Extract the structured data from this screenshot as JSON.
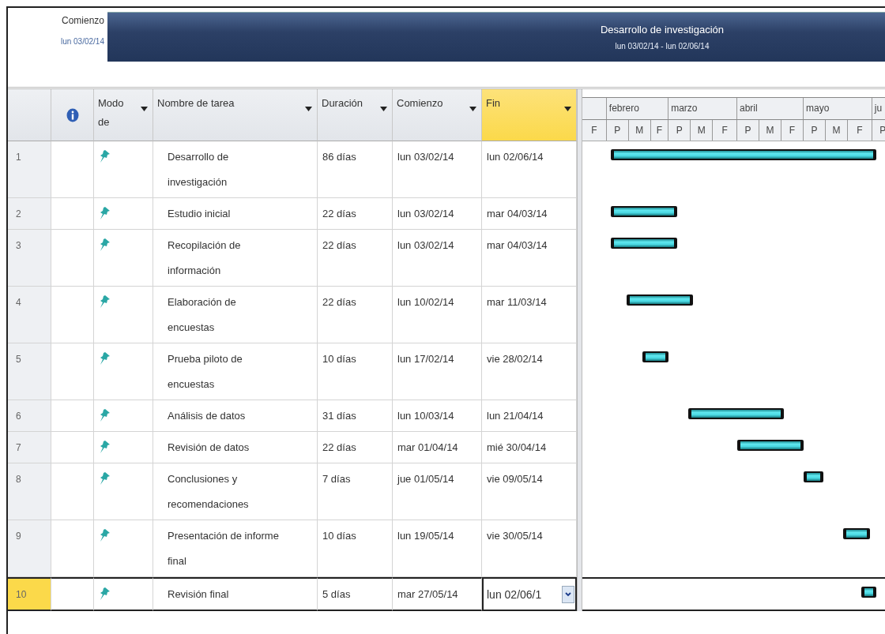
{
  "timeline": {
    "start_label": "Comienzo",
    "start_date": "lun 03/02/14",
    "bar_title": "Desarrollo de investigación",
    "bar_dates": "lun 03/02/14 - lun 02/06/14"
  },
  "table": {
    "columns": [
      {
        "label": "Modo de",
        "selected": false
      },
      {
        "label": "Nombre de tarea",
        "selected": false
      },
      {
        "label": "Duración",
        "selected": false
      },
      {
        "label": "Comienzo",
        "selected": false
      },
      {
        "label": "Fin",
        "selected": true
      }
    ],
    "rows": [
      {
        "id": "1",
        "name": "Desarrollo de investigación",
        "duration": "86 días",
        "start": "lun 03/02/14",
        "finish": "lun 02/06/14",
        "selected": false
      },
      {
        "id": "2",
        "name": "Estudio inicial",
        "duration": "22 días",
        "start": "lun 03/02/14",
        "finish": "mar 04/03/14",
        "selected": false
      },
      {
        "id": "3",
        "name": "Recopilación de información",
        "duration": "22 días",
        "start": "lun 03/02/14",
        "finish": "mar 04/03/14",
        "selected": false
      },
      {
        "id": "4",
        "name": "Elaboración de encuestas",
        "duration": "22 días",
        "start": "lun 10/02/14",
        "finish": "mar 11/03/14",
        "selected": false
      },
      {
        "id": "5",
        "name": "Prueba piloto de encuestas",
        "duration": "10 días",
        "start": "lun 17/02/14",
        "finish": "vie 28/02/14",
        "selected": false
      },
      {
        "id": "6",
        "name": "Análisis de datos",
        "duration": "31 días",
        "start": "lun 10/03/14",
        "finish": "lun 21/04/14",
        "selected": false
      },
      {
        "id": "7",
        "name": "Revisión de datos",
        "duration": "22 días",
        "start": "mar 01/04/14",
        "finish": "mié 30/04/14",
        "selected": false
      },
      {
        "id": "8",
        "name": "Conclusiones y recomendaciones",
        "duration": "7 días",
        "start": "jue 01/05/14",
        "finish": "vie 09/05/14",
        "selected": false
      },
      {
        "id": "9",
        "name": "Presentación de informe final",
        "duration": "10 días",
        "start": "lun 19/05/14",
        "finish": "vie 30/05/14",
        "selected": false
      },
      {
        "id": "10",
        "name": "Revisión final",
        "duration": "5 días",
        "start": "mar 27/05/14",
        "finish": "lun 02/06/1",
        "selected": true
      }
    ]
  },
  "timescale": {
    "months": [
      "febrero",
      "marzo",
      "abril",
      "mayo",
      "ju"
    ],
    "periods": [
      "F",
      "P",
      "M",
      "F",
      "P",
      "M",
      "F",
      "P",
      "M",
      "F",
      "P",
      "M",
      "F",
      "P"
    ]
  }
}
